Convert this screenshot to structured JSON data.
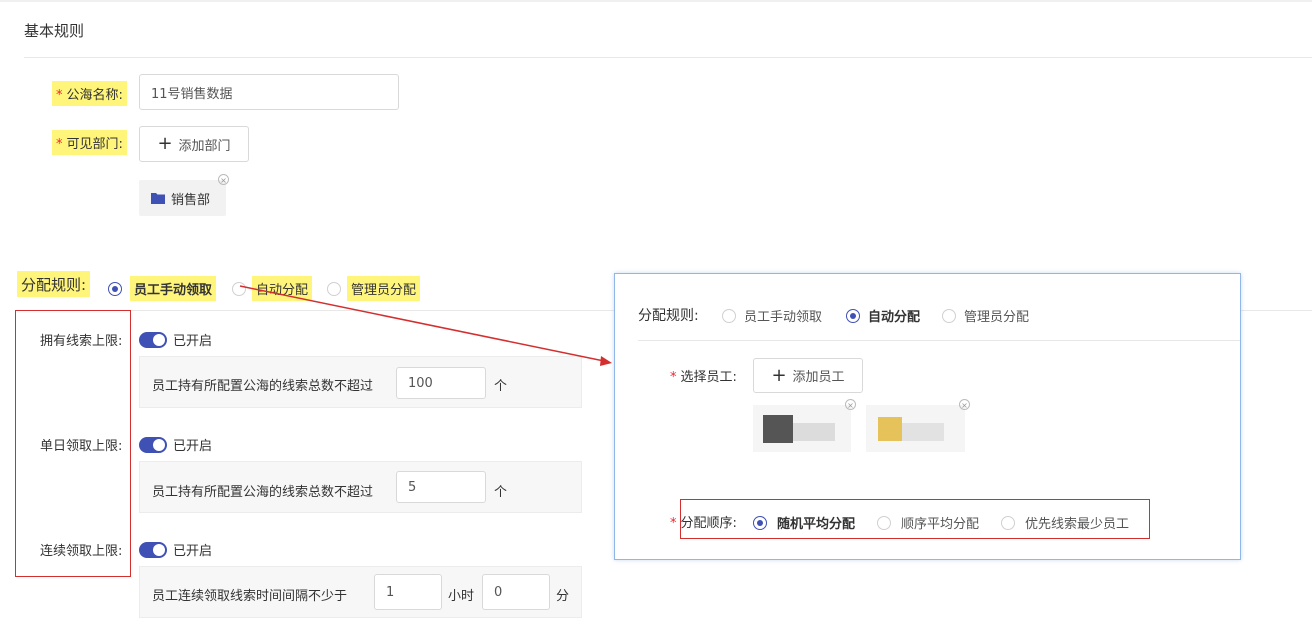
{
  "section_title": "基本规则",
  "pool_name": {
    "label": "公海名称:",
    "value": "11号销售数据"
  },
  "visible_dept": {
    "label": "可见部门:",
    "add_button": "添加部门",
    "tags": [
      "销售部"
    ]
  },
  "assign_rule": {
    "label": "分配规则:",
    "options": [
      "员工手动领取",
      "自动分配",
      "管理员分配"
    ],
    "selected": "员工手动领取"
  },
  "limits": [
    {
      "label": "拥有线索上限:",
      "status": "已开启",
      "text": "员工持有所配置公海的线索总数不超过",
      "value": "100",
      "unit": "个"
    },
    {
      "label": "单日领取上限:",
      "status": "已开启",
      "text": "员工持有所配置公海的线索总数不超过",
      "value": "5",
      "unit": "个"
    },
    {
      "label": "连续领取上限:",
      "status": "已开启",
      "text": "员工连续领取线索时间间隔不少于",
      "value_hours": "1",
      "unit_hours": "小时",
      "value_minutes": "0",
      "unit_minutes": "分"
    }
  ],
  "popup": {
    "rule_label": "分配规则:",
    "options": [
      "员工手动领取",
      "自动分配",
      "管理员分配"
    ],
    "selected": "自动分配",
    "select_staff_label": "选择员工:",
    "add_staff_button": "添加员工",
    "order_label": "分配顺序:",
    "order_options": [
      "随机平均分配",
      "顺序平均分配",
      "优先线索最少员工"
    ],
    "order_selected": "随机平均分配"
  },
  "colors": {
    "accent": "#3f51b5",
    "highlight": "#fff57a",
    "annotation_red": "#d32f2f",
    "popup_border": "#8fb8e8"
  }
}
